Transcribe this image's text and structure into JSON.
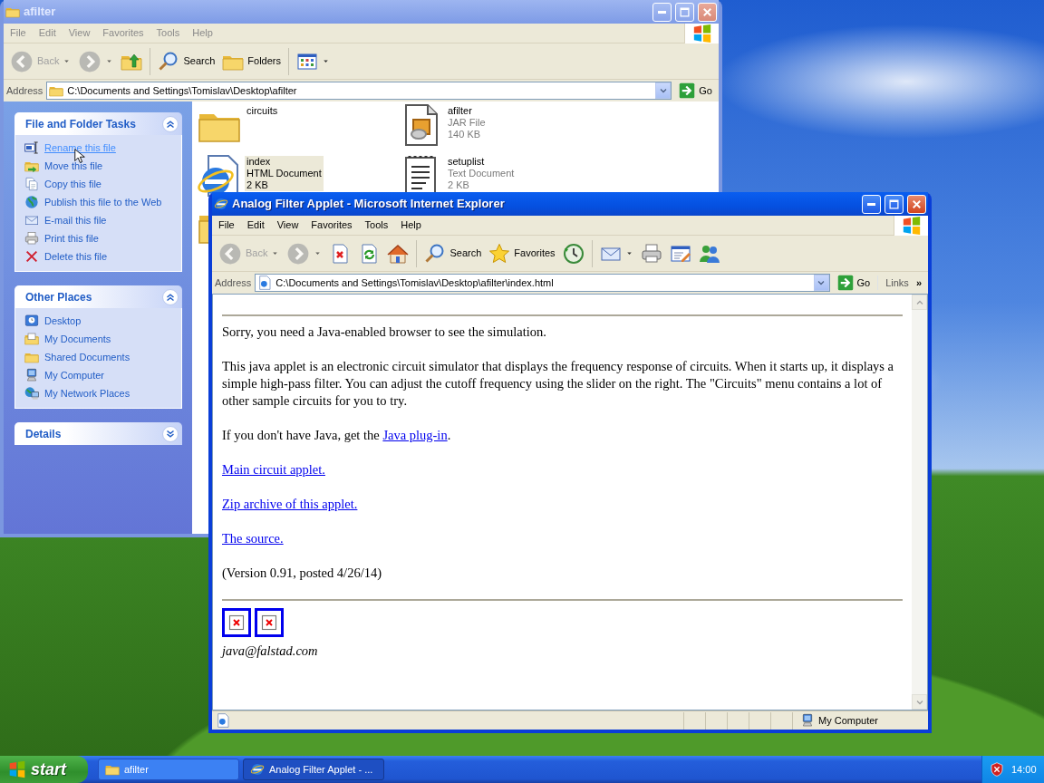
{
  "explorer": {
    "title": "afilter",
    "active": false,
    "menu": [
      "File",
      "Edit",
      "View",
      "Favorites",
      "Tools",
      "Help"
    ],
    "toolbar": [
      {
        "kind": "back",
        "label": "Back",
        "disabled": true
      },
      {
        "kind": "forward",
        "disabled": true
      },
      {
        "kind": "up",
        "disabled": false
      },
      {
        "kind": "separator"
      },
      {
        "kind": "search",
        "label": "Search",
        "disabled": false
      },
      {
        "kind": "folders",
        "label": "Folders",
        "disabled": false
      },
      {
        "kind": "separator"
      },
      {
        "kind": "views",
        "disabled": false
      }
    ],
    "address_label": "Address",
    "address": "C:\\Documents and Settings\\Tomislav\\Desktop\\afilter",
    "go": "Go",
    "panels": [
      {
        "title": "File and Folder Tasks",
        "expanded": true,
        "items": [
          {
            "kind": "rename",
            "label": "Rename this file",
            "hovered": true
          },
          {
            "kind": "move",
            "label": "Move this file",
            "hovered": false
          },
          {
            "kind": "copy",
            "label": "Copy this file",
            "hovered": false
          },
          {
            "kind": "publish",
            "label": "Publish this file to the Web",
            "hovered": false
          },
          {
            "kind": "email",
            "label": "E-mail this file",
            "hovered": false
          },
          {
            "kind": "print",
            "label": "Print this file",
            "hovered": false
          },
          {
            "kind": "delete",
            "label": "Delete this file",
            "hovered": false
          }
        ]
      },
      {
        "title": "Other Places",
        "expanded": true,
        "items": [
          {
            "kind": "desktop",
            "label": "Desktop",
            "hovered": false
          },
          {
            "kind": "documents",
            "label": "My Documents",
            "hovered": false
          },
          {
            "kind": "shared",
            "label": "Shared Documents",
            "hovered": false
          },
          {
            "kind": "computer",
            "label": "My Computer",
            "hovered": false
          },
          {
            "kind": "network",
            "label": "My Network Places",
            "hovered": false
          }
        ]
      },
      {
        "title": "Details",
        "expanded": false
      }
    ],
    "files": [
      {
        "kind": "folder",
        "name": "circuits",
        "selected": false
      },
      {
        "kind": "jar",
        "name": "afilter",
        "type": "JAR File",
        "size": "140 KB",
        "selected": false
      },
      {
        "kind": "html",
        "name": "index",
        "type": "HTML Document",
        "size": "2 KB",
        "selected": true
      },
      {
        "kind": "text",
        "name": "setuplist",
        "type": "Text Document",
        "size": "2 KB",
        "selected": false
      },
      {
        "kind": "zip",
        "selected": false
      }
    ]
  },
  "browser": {
    "title": "Analog Filter Applet - Microsoft Internet Explorer",
    "active": true,
    "menu": [
      "File",
      "Edit",
      "View",
      "Favorites",
      "Tools",
      "Help"
    ],
    "toolbar": [
      {
        "kind": "back",
        "label": "Back",
        "disabled": true
      },
      {
        "kind": "forward",
        "disabled": true
      },
      {
        "kind": "stop",
        "disabled": false
      },
      {
        "kind": "refresh",
        "disabled": false
      },
      {
        "kind": "home",
        "disabled": false
      },
      {
        "kind": "separator"
      },
      {
        "kind": "search",
        "label": "Search",
        "disabled": false
      },
      {
        "kind": "favorites",
        "label": "Favorites",
        "disabled": false
      },
      {
        "kind": "history",
        "disabled": false
      },
      {
        "kind": "separator"
      },
      {
        "kind": "mail",
        "disabled": false
      },
      {
        "kind": "print",
        "disabled": false
      },
      {
        "kind": "edit",
        "disabled": false
      },
      {
        "kind": "messenger",
        "disabled": false
      }
    ],
    "address_label": "Address",
    "address": "C:\\Documents and Settings\\Tomislav\\Desktop\\afilter\\index.html",
    "go": "Go",
    "links": "Links",
    "links_more": "»",
    "content": [
      {
        "kind": "rule"
      },
      {
        "kind": "text",
        "text": "Sorry, you need a Java-enabled browser to see the simulation."
      },
      {
        "kind": "text",
        "text": "This java applet is an electronic circuit simulator that displays the frequency response of circuits. When it starts up, it displays a simple high-pass filter. You can adjust the cutoff frequency using the slider on the right. The \"Circuits\" menu contains a lot of other sample circuits for you to try."
      },
      {
        "kind": "text_link",
        "text": "If you don't have Java, get the ",
        "link": "Java plug-in",
        "after": "."
      },
      {
        "kind": "link",
        "text": "Main circuit applet."
      },
      {
        "kind": "link",
        "text": "Zip archive of this applet."
      },
      {
        "kind": "link",
        "text": "The source."
      },
      {
        "kind": "text",
        "text": "(Version 0.91, posted 4/26/14)"
      },
      {
        "kind": "rule"
      },
      {
        "kind": "images",
        "images": [
          {
            "broken": true
          },
          {
            "broken": true
          }
        ]
      },
      {
        "kind": "address",
        "text": "java@falstad.com"
      }
    ],
    "status": {
      "zone": "My Computer"
    }
  },
  "taskbar": {
    "start": "start",
    "tasks": [
      {
        "kind": "folder",
        "label": "afilter",
        "selected": false
      },
      {
        "kind": "browser",
        "label": "Analog Filter Applet - ...",
        "selected": true
      }
    ],
    "clock": "14:00"
  }
}
